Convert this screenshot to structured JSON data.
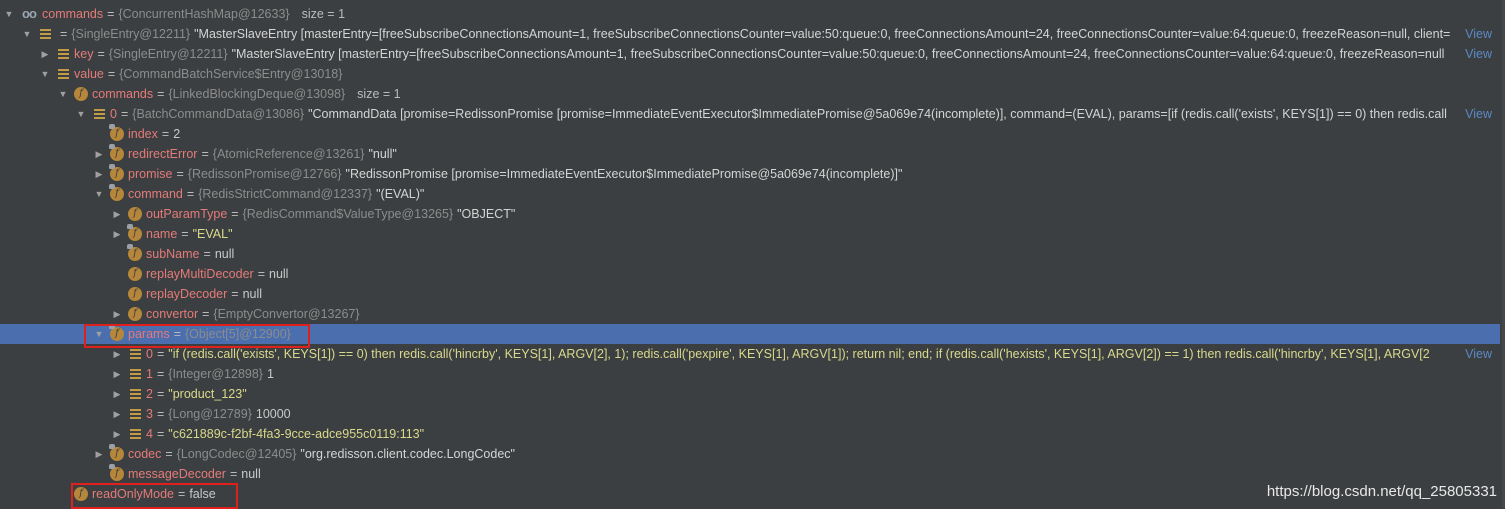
{
  "rows": [
    {
      "level": 0,
      "arrow": "expanded",
      "icon": "watch",
      "name": "commands",
      "type": "{ConcurrentHashMap@12633}",
      "value": "",
      "extra": "size = 1"
    },
    {
      "level": 1,
      "arrow": "expanded",
      "icon": "array",
      "name": "",
      "type": "{SingleEntry@12211}",
      "value": "\"MasterSlaveEntry [masterEntry=[freeSubscribeConnectionsAmount=1, freeSubscribeConnectionsCounter=value:50:queue:0, freeConnectionsAmount=24, freeConnectionsCounter=value:64:queue:0, freezeReason=null, client=",
      "view": "View"
    },
    {
      "level": 2,
      "arrow": "collapsed",
      "icon": "array",
      "name": "key",
      "type": "{SingleEntry@12211}",
      "value": "\"MasterSlaveEntry [masterEntry=[freeSubscribeConnectionsAmount=1, freeSubscribeConnectionsCounter=value:50:queue:0, freeConnectionsAmount=24, freeConnectionsCounter=value:64:queue:0, freezeReason=null",
      "view": "View"
    },
    {
      "level": 2,
      "arrow": "expanded",
      "icon": "array",
      "name": "value",
      "type": "{CommandBatchService$Entry@13018}",
      "value": ""
    },
    {
      "level": 3,
      "arrow": "expanded",
      "icon": "field",
      "name": "commands",
      "type": "{LinkedBlockingDeque@13098}",
      "value": "",
      "extra": "size = 1"
    },
    {
      "level": 4,
      "arrow": "expanded",
      "icon": "array",
      "name": "0",
      "type": "{BatchCommandData@13086}",
      "value": "\"CommandData [promise=RedissonPromise [promise=ImmediateEventExecutor$ImmediatePromise@5a069e74(incomplete)], command=(EVAL), params=[if (redis.call('exists', KEYS[1]) == 0) then redis.call",
      "view": "View"
    },
    {
      "level": 5,
      "arrow": "none",
      "icon": "field-final",
      "name": "index",
      "type": "",
      "value": "2",
      "kind": "plain"
    },
    {
      "level": 5,
      "arrow": "collapsed",
      "icon": "field-final",
      "name": "redirectError",
      "type": "{AtomicReference@13261}",
      "value": "\"null\""
    },
    {
      "level": 5,
      "arrow": "collapsed",
      "icon": "field-final",
      "name": "promise",
      "type": "{RedissonPromise@12766}",
      "value": "\"RedissonPromise [promise=ImmediateEventExecutor$ImmediatePromise@5a069e74(incomplete)]\""
    },
    {
      "level": 5,
      "arrow": "expanded",
      "icon": "field-final",
      "name": "command",
      "type": "{RedisStrictCommand@12337}",
      "value": "\"(EVAL)\""
    },
    {
      "level": 6,
      "arrow": "collapsed",
      "icon": "field",
      "name": "outParamType",
      "type": "{RedisCommand$ValueType@13265}",
      "value": "\"OBJECT\""
    },
    {
      "level": 6,
      "arrow": "collapsed",
      "icon": "field-final",
      "name": "name",
      "type": "",
      "value": "\"EVAL\"",
      "kind": "str"
    },
    {
      "level": 6,
      "arrow": "none",
      "icon": "field-final",
      "name": "subName",
      "type": "",
      "value": "null",
      "kind": "plain"
    },
    {
      "level": 6,
      "arrow": "none",
      "icon": "field",
      "name": "replayMultiDecoder",
      "type": "",
      "value": "null",
      "kind": "plain"
    },
    {
      "level": 6,
      "arrow": "none",
      "icon": "field",
      "name": "replayDecoder",
      "type": "",
      "value": "null",
      "kind": "plain"
    },
    {
      "level": 6,
      "arrow": "collapsed",
      "icon": "field",
      "name": "convertor",
      "type": "{EmptyConvertor@13267}",
      "value": ""
    },
    {
      "level": 5,
      "arrow": "expanded",
      "icon": "field-final",
      "name": "params",
      "type": "{Object[5]@12900}",
      "value": "",
      "selected": true
    },
    {
      "level": 6,
      "arrow": "collapsed",
      "icon": "array",
      "name": "0",
      "type": "",
      "value": "\"if (redis.call('exists', KEYS[1]) == 0) then redis.call('hincrby', KEYS[1], ARGV[2], 1); redis.call('pexpire', KEYS[1], ARGV[1]); return nil; end; if (redis.call('hexists', KEYS[1], ARGV[2]) == 1) then redis.call('hincrby', KEYS[1], ARGV[2",
      "kind": "str",
      "view": "View"
    },
    {
      "level": 6,
      "arrow": "collapsed",
      "icon": "array",
      "name": "1",
      "type": "{Integer@12898}",
      "value": "1",
      "kind": "plain"
    },
    {
      "level": 6,
      "arrow": "collapsed",
      "icon": "array",
      "name": "2",
      "type": "",
      "value": "\"product_123\"",
      "kind": "str"
    },
    {
      "level": 6,
      "arrow": "collapsed",
      "icon": "array",
      "name": "3",
      "type": "{Long@12789}",
      "value": "10000",
      "kind": "plain"
    },
    {
      "level": 6,
      "arrow": "collapsed",
      "icon": "array",
      "name": "4",
      "type": "",
      "value": "\"c621889c-f2bf-4fa3-9cce-adce955c0119:113\"",
      "kind": "str"
    },
    {
      "level": 5,
      "arrow": "collapsed",
      "icon": "field-final",
      "name": "codec",
      "type": "{LongCodec@12405}",
      "value": "\"org.redisson.client.codec.LongCodec\""
    },
    {
      "level": 5,
      "arrow": "none",
      "icon": "field-final",
      "name": "messageDecoder",
      "type": "",
      "value": "null",
      "kind": "plain"
    },
    {
      "level": 3,
      "arrow": "none",
      "icon": "field",
      "name": "readOnlyMode",
      "type": "",
      "value": "false",
      "kind": "plain"
    }
  ],
  "watermark": "https://blog.csdn.net/qq_25805331",
  "colors": {
    "background": "#3c3f41",
    "selection": "#4b6eaf",
    "highlight_box": "#e0201c",
    "field_name": "#e47b79",
    "string": "#d9d98b",
    "link": "#5a8ac6"
  }
}
